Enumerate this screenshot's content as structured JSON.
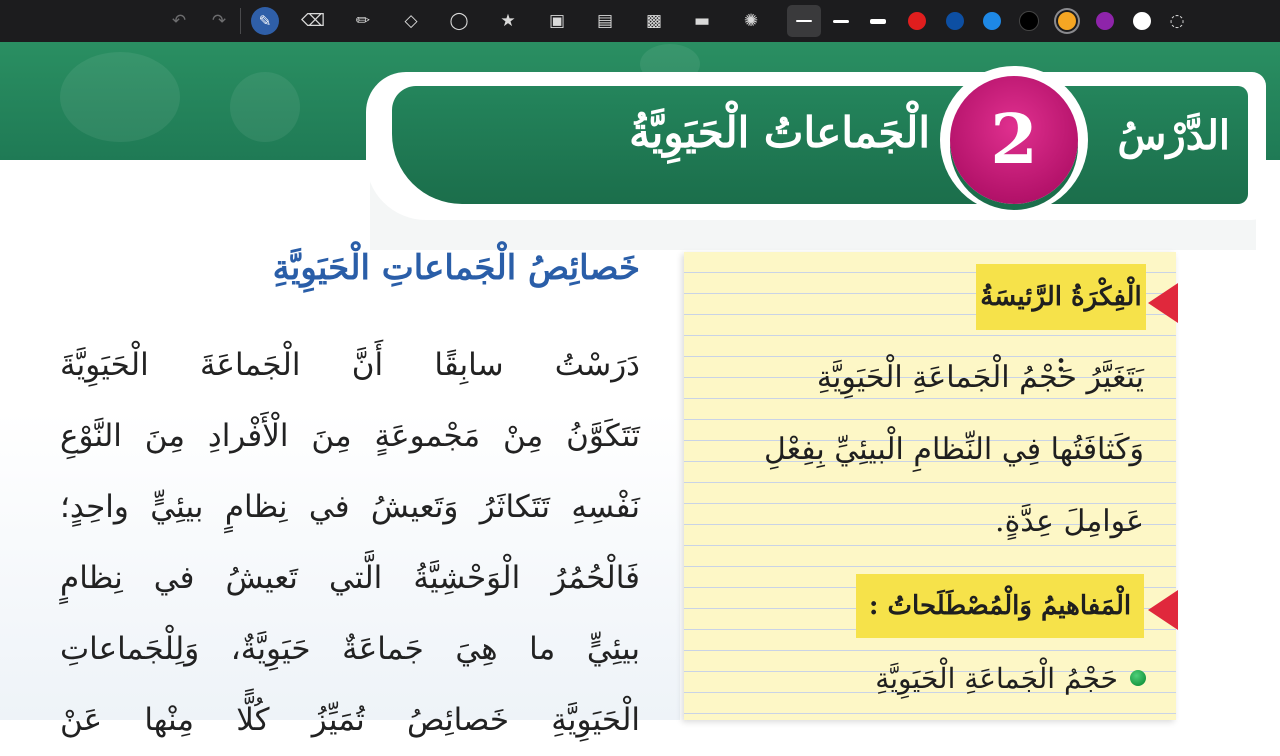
{
  "toolbar": {
    "undo_icon": "undo-icon",
    "redo_icon": "redo-icon",
    "tools": [
      "pen-icon",
      "eraser-icon",
      "highlighter-icon",
      "shapes-icon",
      "lasso-icon",
      "star-sticker-icon",
      "image-icon",
      "text-icon",
      "scan-icon",
      "ruler-icon",
      "laser-pointer-icon"
    ],
    "stroke_widths": [
      "thin",
      "medium",
      "thick"
    ],
    "colors": [
      "#e01e1e",
      "#0d4fa3",
      "#1e88e5",
      "#000000",
      "#f5a623",
      "#8e24aa",
      "#ffffff"
    ],
    "selected_color": "#f5a623"
  },
  "banner": {
    "lesson_word": "الدَّرْسُ",
    "lesson_number": "2",
    "lesson_title": "الْجَماعاتُ الْحَيَوِيَّةُ",
    "accent_green": "#1f7a55",
    "number_color": "#c2166f"
  },
  "main": {
    "heading": "خَصائِصُ الْجَماعاتِ الْحَيَوِيَّةِ",
    "paragraph_lines": [
      "دَرَسْتُ سابِقًا أَنَّ الْجَماعَةَ الْحَيَوِيَّةَ",
      "تَتَكَوَّنُ مِنْ مَجْموعَةٍ مِنَ الْأَفْرادِ مِنَ النَّوْعِ",
      "نَفْسِهِ تَتَكاثَرُ وَتَعيشُ في نِظامٍ بيئِيٍّ واحِدٍ؛",
      "فَالْحُمُرُ الْوَحْشِيَّةُ الَّتي تَعيشُ في نِظامٍ",
      "بيئِيٍّ ما هِيَ جَماعَةٌ حَيَوِيَّةٌ، وَلِلْجَماعاتِ",
      "الْحَيَوِيَّةِ خَصائِصُ تُمَيِّزُ كُلًّا مِنْها عَنْ"
    ]
  },
  "note": {
    "main_idea_label": "الْفِكْرَةُ الرَّئيسَةُ :",
    "main_idea_lines": [
      "يَتَغَيَّرُ حَجْمُ الْجَماعَةِ الْحَيَوِيَّةِ",
      "وَكَثافَتُها فِي النِّظامِ الْبيئِيِّ بِفِعْلِ",
      "عَوامِلَ عِدَّةٍ."
    ],
    "concepts_label": "الْمَفاهيمُ وَالْمُصْطَلَحاتُ :",
    "concepts": [
      "حَجْمُ الْجَماعَةِ الْحَيَوِيَّةِ"
    ],
    "paper_color": "#fdf7c6",
    "label_bg": "#f6e24a",
    "pointer_color": "#e0283c"
  }
}
